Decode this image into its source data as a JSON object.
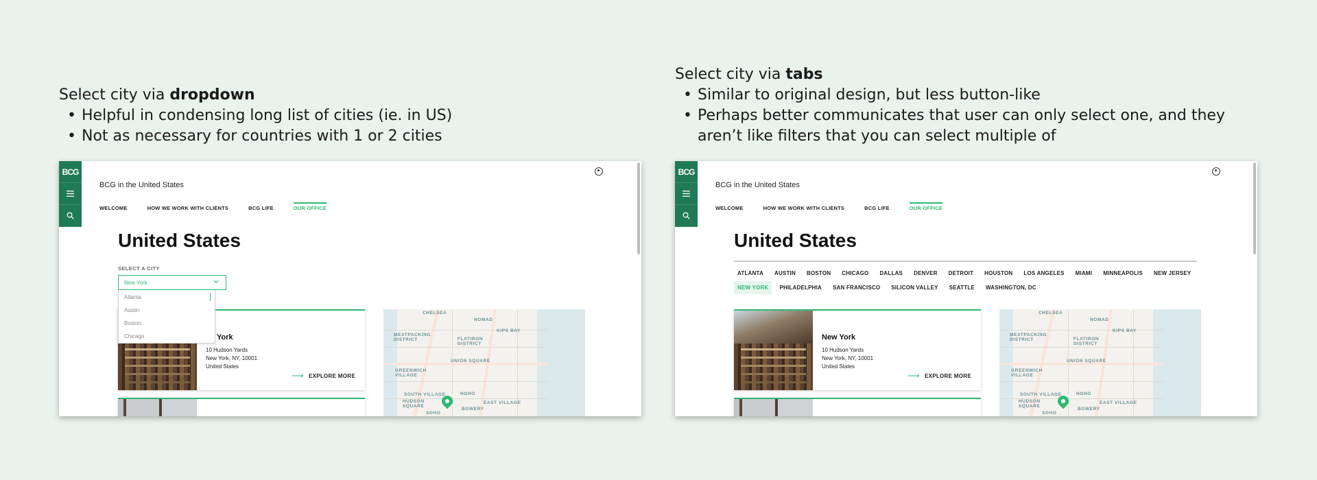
{
  "left_note": {
    "title_prefix": "Select city via ",
    "title_bold": "dropdown",
    "bullets": [
      "Helpful in condensing long list of cities (ie. in US)",
      "Not as necessary for countries with 1 or 2 cities"
    ]
  },
  "right_note": {
    "title_prefix": "Select city via ",
    "title_bold": "tabs",
    "bullets": [
      "Similar to original design, but less button-like",
      "Perhaps better communicates that user can only select one, and they aren’t like filters that you can select multiple of"
    ]
  },
  "site": {
    "logo": "BCG",
    "title": "BCG in the United States",
    "nav": [
      "WELCOME",
      "HOW WE WORK WITH CLIENTS",
      "BCG LIFE",
      "OUR OFFICE"
    ],
    "active_nav": "OUR OFFICE",
    "heading": "United States",
    "accent_color": "#2eb872",
    "sidebar_color": "#1f7a55"
  },
  "dropdown": {
    "label": "SELECT A CITY",
    "selected": "New York",
    "options": [
      "Atlanta",
      "Austin",
      "Boston",
      "Chicago"
    ]
  },
  "tabs": {
    "items": [
      "ATLANTA",
      "AUSTIN",
      "BOSTON",
      "CHICAGO",
      "DALLAS",
      "DENVER",
      "DETROIT",
      "HOUSTON",
      "LOS ANGELES",
      "MIAMI",
      "MINNEAPOLIS",
      "NEW JERSEY",
      "NEW YORK",
      "PHILADELPHIA",
      "SAN FRANCISCO",
      "SILICON VALLEY",
      "SEATTLE",
      "WASHINGTON, DC"
    ],
    "active": "NEW YORK"
  },
  "office": {
    "name": "New York",
    "name_partial": "York",
    "address_line1": "10 Hudson Yards",
    "address_line2": "New York, NY, 10001",
    "address_line3": "United States",
    "explore": "EXPLORE MORE"
  },
  "map": {
    "labels": [
      "CHELSEA",
      "NOMAD",
      "KIPS BAY",
      "MEATPACKING DISTRICT",
      "FLATIRON DISTRICT",
      "UNION SQUARE",
      "GREENWICH VILLAGE",
      "SOUTH VILLAGE",
      "NOHO",
      "HUDSON SQUARE",
      "EAST VILLAGE",
      "SOHO",
      "BOWERY"
    ]
  }
}
